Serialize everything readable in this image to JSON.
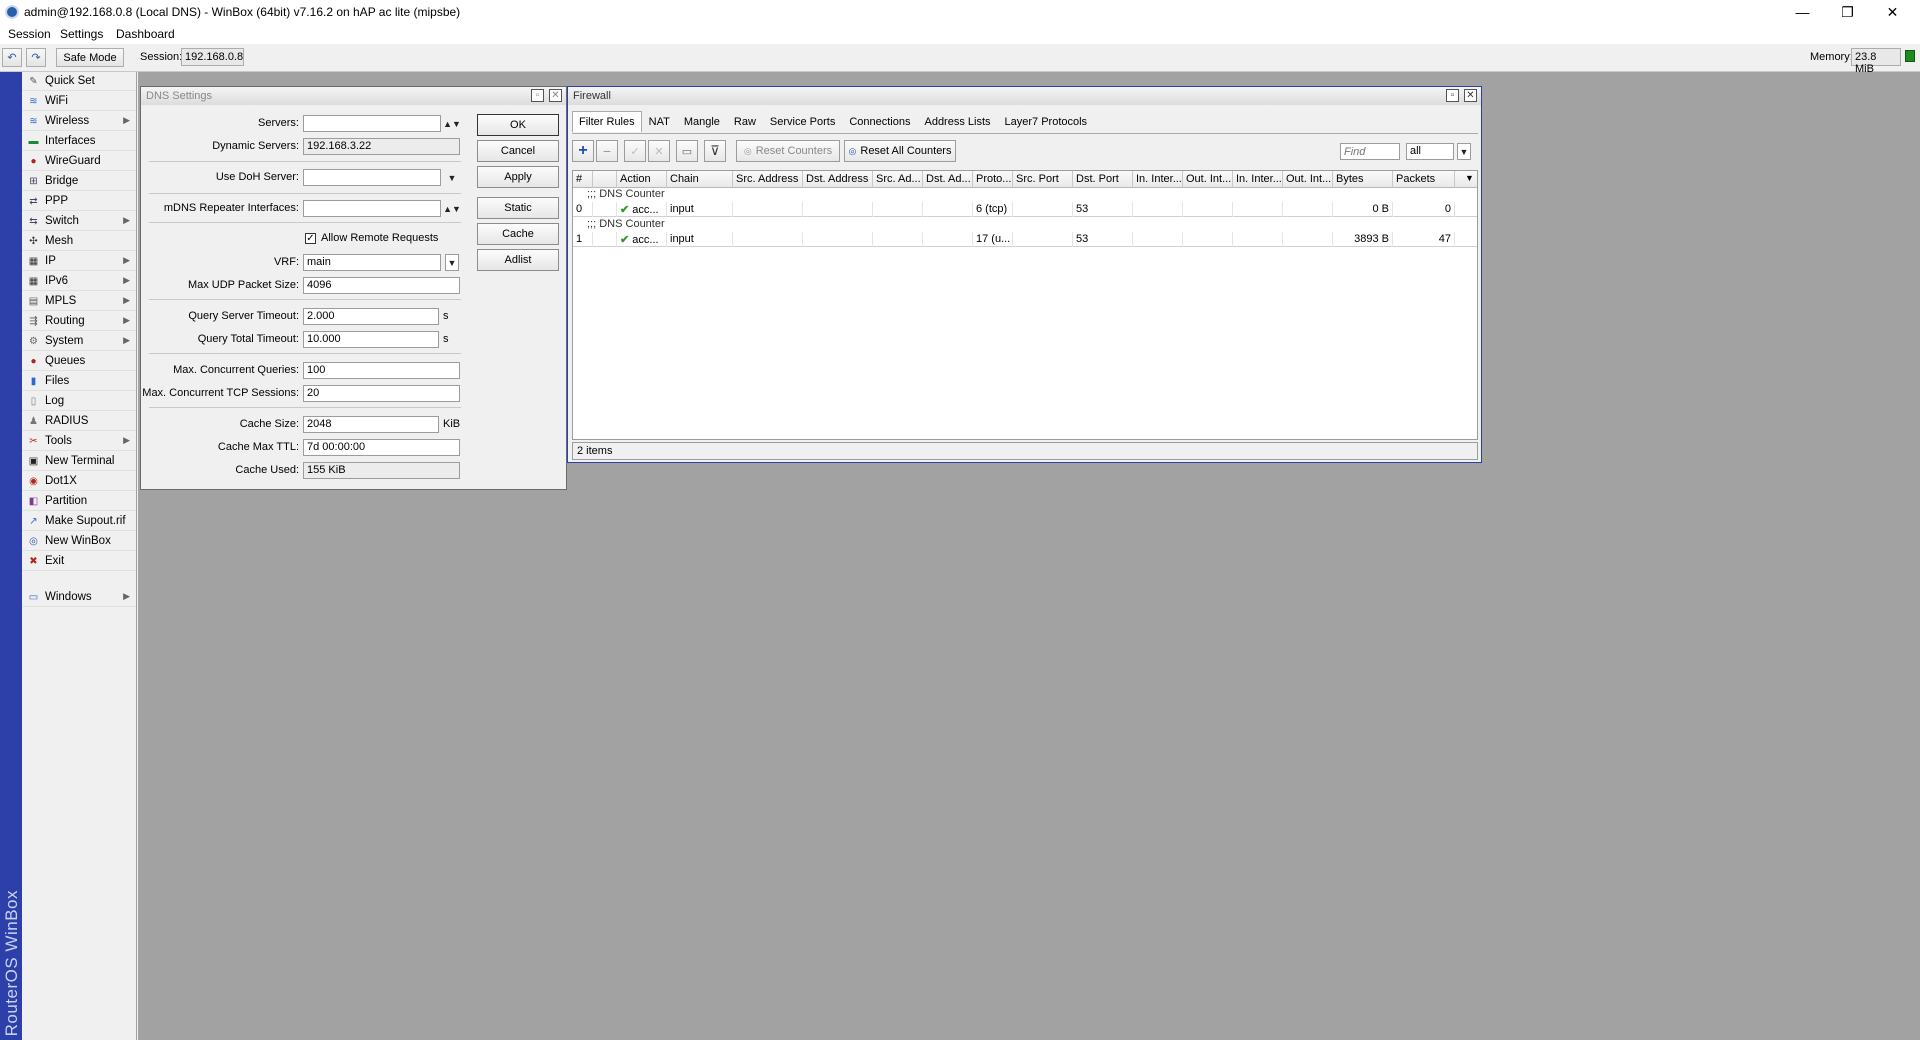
{
  "window": {
    "title": "admin@192.168.0.8 (Local DNS) - WinBox (64bit) v7.16.2 on hAP ac lite (mipsbe)",
    "controls": {
      "minimize": "—",
      "maximize": "❐",
      "close": "✕"
    }
  },
  "menu": {
    "items": [
      "Session",
      "Settings",
      "Dashboard"
    ]
  },
  "toolbar": {
    "undo_icon": "↶",
    "redo_icon": "↷",
    "safe_mode": "Safe Mode",
    "session_label": "Session:",
    "session_value": "192.168.0.8",
    "memory_label": "Memory:",
    "memory_value": "23.8 MiB"
  },
  "brand": "RouterOS WinBox",
  "sidebar": {
    "items": [
      {
        "label": "Quick Set",
        "icon": "quick-set-icon",
        "glyph": "✎",
        "color": "#555",
        "arrow": false
      },
      {
        "label": "WiFi",
        "icon": "wifi-icon",
        "glyph": "≋",
        "color": "#2a6ad0",
        "arrow": false
      },
      {
        "label": "Wireless",
        "icon": "wireless-icon",
        "glyph": "≋",
        "color": "#2a6ad0",
        "arrow": true
      },
      {
        "label": "Interfaces",
        "icon": "interfaces-icon",
        "glyph": "▬",
        "color": "#1a8a3a",
        "arrow": false
      },
      {
        "label": "WireGuard",
        "icon": "wireguard-icon",
        "glyph": "●",
        "color": "#b0261e",
        "arrow": false
      },
      {
        "label": "Bridge",
        "icon": "bridge-icon",
        "glyph": "⊞",
        "color": "#446",
        "arrow": false
      },
      {
        "label": "PPP",
        "icon": "ppp-icon",
        "glyph": "⇄",
        "color": "#446",
        "arrow": false
      },
      {
        "label": "Switch",
        "icon": "switch-icon",
        "glyph": "⇆",
        "color": "#446",
        "arrow": true
      },
      {
        "label": "Mesh",
        "icon": "mesh-icon",
        "glyph": "✣",
        "color": "#333",
        "arrow": false
      },
      {
        "label": "IP",
        "icon": "ip-icon",
        "glyph": "▦",
        "color": "#333",
        "arrow": true
      },
      {
        "label": "IPv6",
        "icon": "ipv6-icon",
        "glyph": "▦",
        "color": "#333",
        "arrow": true
      },
      {
        "label": "MPLS",
        "icon": "mpls-icon",
        "glyph": "▤",
        "color": "#555",
        "arrow": true
      },
      {
        "label": "Routing",
        "icon": "routing-icon",
        "glyph": "⇶",
        "color": "#555",
        "arrow": true
      },
      {
        "label": "System",
        "icon": "system-icon",
        "glyph": "⚙",
        "color": "#666",
        "arrow": true
      },
      {
        "label": "Queues",
        "icon": "queues-icon",
        "glyph": "●",
        "color": "#b0261e",
        "arrow": false
      },
      {
        "label": "Files",
        "icon": "files-icon",
        "glyph": "▮",
        "color": "#2a6ad0",
        "arrow": false
      },
      {
        "label": "Log",
        "icon": "log-icon",
        "glyph": "▯",
        "color": "#777",
        "arrow": false
      },
      {
        "label": "RADIUS",
        "icon": "radius-icon",
        "glyph": "♟",
        "color": "#777",
        "arrow": false
      },
      {
        "label": "Tools",
        "icon": "tools-icon",
        "glyph": "✂",
        "color": "#b0261e",
        "arrow": true
      },
      {
        "label": "New Terminal",
        "icon": "terminal-icon",
        "glyph": "▣",
        "color": "#222",
        "arrow": false
      },
      {
        "label": "Dot1X",
        "icon": "dot1x-icon",
        "glyph": "◉",
        "color": "#b0261e",
        "arrow": false
      },
      {
        "label": "Partition",
        "icon": "partition-icon",
        "glyph": "◧",
        "color": "#7a3a9a",
        "arrow": false
      },
      {
        "label": "Make Supout.rif",
        "icon": "supout-icon",
        "glyph": "↗",
        "color": "#2a6ad0",
        "arrow": false
      },
      {
        "label": "New WinBox",
        "icon": "winbox-icon",
        "glyph": "◎",
        "color": "#2a5da8",
        "arrow": false
      },
      {
        "label": "Exit",
        "icon": "exit-icon",
        "glyph": "✖",
        "color": "#b0261e",
        "arrow": false
      },
      {
        "label": "Windows",
        "icon": "windows-icon",
        "glyph": "▭",
        "color": "#2a6ad0",
        "arrow": true
      }
    ]
  },
  "dns": {
    "title": "DNS Settings",
    "labels": {
      "servers": "Servers:",
      "dynamic_servers": "Dynamic Servers:",
      "use_doh_server": "Use DoH Server:",
      "mdns": "mDNS Repeater Interfaces:",
      "allow_remote": "Allow Remote Requests",
      "vrf": "VRF:",
      "max_udp": "Max UDP Packet Size:",
      "query_server_timeout": "Query Server Timeout:",
      "query_total_timeout": "Query Total Timeout:",
      "max_concurrent_queries": "Max. Concurrent Queries:",
      "max_concurrent_tcp": "Max. Concurrent TCP Sessions:",
      "cache_size": "Cache Size:",
      "cache_max_ttl": "Cache Max TTL:",
      "cache_used": "Cache Used:"
    },
    "values": {
      "servers": "",
      "dynamic_servers": "192.168.3.22",
      "use_doh_server": "",
      "mdns": "",
      "allow_remote": true,
      "vrf": "main",
      "max_udp": "4096",
      "query_server_timeout": "2.000",
      "query_total_timeout": "10.000",
      "max_concurrent_queries": "100",
      "max_concurrent_tcp": "20",
      "cache_size": "2048",
      "cache_max_ttl": "7d 00:00:00",
      "cache_used": "155 KiB"
    },
    "units": {
      "seconds": "s",
      "kib": "KiB"
    },
    "buttons": {
      "ok": "OK",
      "cancel": "Cancel",
      "apply": "Apply",
      "static": "Static",
      "cache": "Cache",
      "adlist": "Adlist"
    }
  },
  "firewall": {
    "title": "Firewall",
    "tabs": [
      "Filter Rules",
      "NAT",
      "Mangle",
      "Raw",
      "Service Ports",
      "Connections",
      "Address Lists",
      "Layer7 Protocols"
    ],
    "active_tab": 0,
    "toolbar": {
      "add_icon": "+",
      "remove_icon": "−",
      "enable_icon": "✓",
      "disable_icon": "✕",
      "comment_icon": "▭",
      "filter_icon": "⊽",
      "reset_counters": "Reset Counters",
      "reset_all_counters": "Reset All Counters",
      "find_placeholder": "Find",
      "filter_value": "all"
    },
    "columns": [
      "#",
      "",
      "Action",
      "Chain",
      "Src. Address",
      "Dst. Address",
      "Src. Ad...",
      "Dst. Ad...",
      "Proto...",
      "Src. Port",
      "Dst. Port",
      "In. Inter...",
      "Out. Int...",
      "In. Inter...",
      "Out. Int...",
      "Bytes",
      "Packets"
    ],
    "rows": [
      {
        "comment": ";;; DNS Counter",
        "num": "0",
        "action": "acc...",
        "chain": "input",
        "protocol": "6 (tcp)",
        "dst_port": "53",
        "bytes": "0 B",
        "packets": "0"
      },
      {
        "comment": ";;; DNS Counter",
        "num": "1",
        "action": "acc...",
        "chain": "input",
        "protocol": "17 (u...",
        "dst_port": "53",
        "bytes": "3893 B",
        "packets": "47"
      }
    ],
    "status": "2 items"
  }
}
